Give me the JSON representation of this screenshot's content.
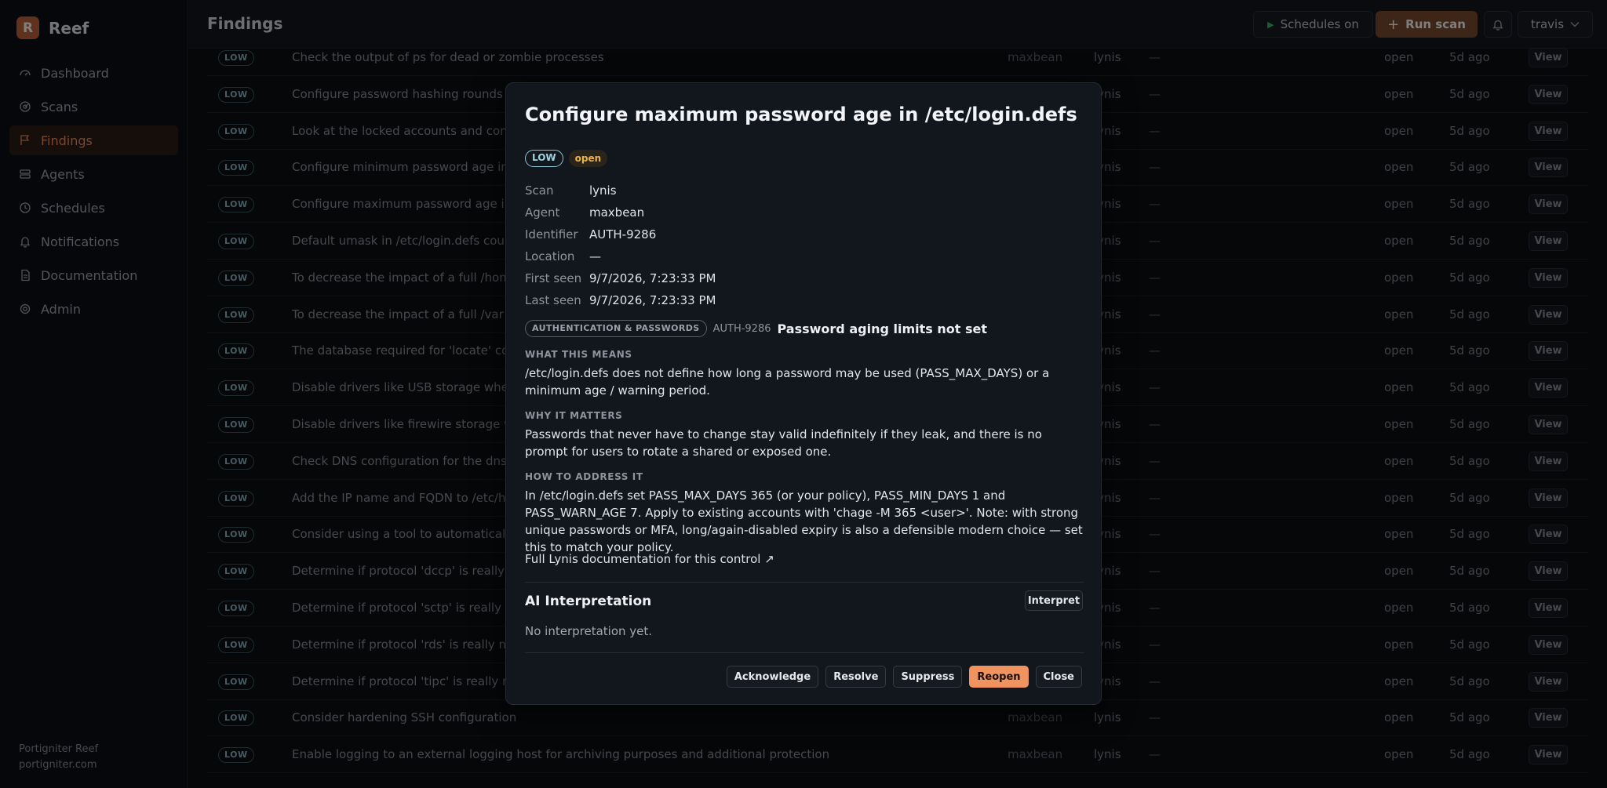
{
  "app": {
    "logo_letter": "R",
    "name": "Reef"
  },
  "sidebar": {
    "items": [
      {
        "label": "Dashboard",
        "icon": "gauge-icon",
        "active": false
      },
      {
        "label": "Scans",
        "icon": "radar-icon",
        "active": false
      },
      {
        "label": "Findings",
        "icon": "flag-icon",
        "active": true
      },
      {
        "label": "Agents",
        "icon": "server-icon",
        "active": false
      },
      {
        "label": "Schedules",
        "icon": "clock-icon",
        "active": false
      },
      {
        "label": "Notifications",
        "icon": "bell-icon",
        "active": false
      },
      {
        "label": "Documentation",
        "icon": "doc-icon",
        "active": false
      },
      {
        "label": "Admin",
        "icon": "gear-icon",
        "active": false
      }
    ],
    "footer": {
      "line1": "Portigniter Reef",
      "line2": "portigniter.com"
    }
  },
  "header": {
    "title": "Findings",
    "schedules_label": "Schedules on",
    "run_scan_label": "Run scan",
    "user": "travis"
  },
  "table": {
    "rows": [
      {
        "severity": "LOW",
        "title": "Check the output of ps for dead or zombie processes",
        "agent": "maxbean",
        "scan": "lynis",
        "location": "—",
        "status": "open",
        "age": "5d ago",
        "view": "View"
      },
      {
        "severity": "LOW",
        "title": "Configure password hashing rounds in",
        "agent": "",
        "scan": "lynis",
        "location": "—",
        "status": "open",
        "age": "5d ago",
        "view": "View"
      },
      {
        "severity": "LOW",
        "title": "Look at the locked accounts and cons",
        "agent": "",
        "scan": "lynis",
        "location": "—",
        "status": "open",
        "age": "5d ago",
        "view": "View"
      },
      {
        "severity": "LOW",
        "title": "Configure minimum password age in",
        "agent": "",
        "scan": "lynis",
        "location": "—",
        "status": "open",
        "age": "5d ago",
        "view": "View"
      },
      {
        "severity": "LOW",
        "title": "Configure maximum password age in",
        "agent": "",
        "scan": "lynis",
        "location": "—",
        "status": "open",
        "age": "5d ago",
        "view": "View"
      },
      {
        "severity": "LOW",
        "title": "Default umask in /etc/login.defs could",
        "agent": "",
        "scan": "lynis",
        "location": "—",
        "status": "open",
        "age": "5d ago",
        "view": "View"
      },
      {
        "severity": "LOW",
        "title": "To decrease the impact of a full /home",
        "agent": "",
        "scan": "lynis",
        "location": "—",
        "status": "open",
        "age": "5d ago",
        "view": "View"
      },
      {
        "severity": "LOW",
        "title": "To decrease the impact of a full /var fi",
        "agent": "",
        "scan": "lynis",
        "location": "—",
        "status": "open",
        "age": "5d ago",
        "view": "View"
      },
      {
        "severity": "LOW",
        "title": "The database required for 'locate' cou",
        "agent": "",
        "scan": "lynis",
        "location": "—",
        "status": "open",
        "age": "5d ago",
        "view": "View"
      },
      {
        "severity": "LOW",
        "title": "Disable drivers like USB storage when n",
        "agent": "",
        "scan": "lynis",
        "location": "—",
        "status": "open",
        "age": "5d ago",
        "view": "View"
      },
      {
        "severity": "LOW",
        "title": "Disable drivers like firewire storage whe",
        "agent": "",
        "scan": "lynis",
        "location": "—",
        "status": "open",
        "age": "5d ago",
        "view": "View"
      },
      {
        "severity": "LOW",
        "title": "Check DNS configuration for the dns do",
        "agent": "",
        "scan": "lynis",
        "location": "—",
        "status": "open",
        "age": "5d ago",
        "view": "View"
      },
      {
        "severity": "LOW",
        "title": "Add the IP name and FQDN to /etc/hos",
        "agent": "",
        "scan": "lynis",
        "location": "—",
        "status": "open",
        "age": "5d ago",
        "view": "View"
      },
      {
        "severity": "LOW",
        "title": "Consider using a tool to automatically",
        "agent": "",
        "scan": "lynis",
        "location": "—",
        "status": "open",
        "age": "5d ago",
        "view": "View"
      },
      {
        "severity": "LOW",
        "title": "Determine if protocol 'dccp' is really ne",
        "agent": "",
        "scan": "lynis",
        "location": "—",
        "status": "open",
        "age": "5d ago",
        "view": "View"
      },
      {
        "severity": "LOW",
        "title": "Determine if protocol 'sctp' is really nee",
        "agent": "",
        "scan": "lynis",
        "location": "—",
        "status": "open",
        "age": "5d ago",
        "view": "View"
      },
      {
        "severity": "LOW",
        "title": "Determine if protocol 'rds' is really need",
        "agent": "",
        "scan": "lynis",
        "location": "—",
        "status": "open",
        "age": "5d ago",
        "view": "View"
      },
      {
        "severity": "LOW",
        "title": "Determine if protocol 'tipc' is really nee",
        "agent": "",
        "scan": "lynis",
        "location": "—",
        "status": "open",
        "age": "5d ago",
        "view": "View"
      },
      {
        "severity": "LOW",
        "title": "Consider hardening SSH configuration",
        "agent": "maxbean",
        "scan": "lynis",
        "location": "—",
        "status": "open",
        "age": "5d ago",
        "view": "View"
      },
      {
        "severity": "LOW",
        "title": "Enable logging to an external logging host for archiving purposes and additional protection",
        "agent": "maxbean",
        "scan": "lynis",
        "location": "—",
        "status": "open",
        "age": "5d ago",
        "view": "View"
      }
    ]
  },
  "modal": {
    "title": "Configure maximum password age in /etc/login.defs",
    "severity": "LOW",
    "status": "open",
    "meta": [
      {
        "key": "Scan",
        "value": "lynis"
      },
      {
        "key": "Agent",
        "value": "maxbean"
      },
      {
        "key": "Identifier",
        "value": "AUTH-9286"
      },
      {
        "key": "Location",
        "value": "—"
      },
      {
        "key": "First seen",
        "value": "9/7/2026, 7:23:33 PM"
      },
      {
        "key": "Last seen",
        "value": "9/7/2026, 7:23:33 PM"
      }
    ],
    "category": "AUTHENTICATION & PASSWORDS",
    "control_id": "AUTH-9286",
    "control_name": "Password aging limits not set",
    "what_heading": "WHAT THIS MEANS",
    "what_text": "/etc/login.defs does not define how long a password may be used (PASS_MAX_DAYS) or a minimum age / warning period.",
    "why_heading": "WHY IT MATTERS",
    "why_text": "Passwords that never have to change stay valid indefinitely if they leak, and there is no prompt for users to rotate a shared or exposed one.",
    "how_heading": "HOW TO ADDRESS IT",
    "how_text": "In /etc/login.defs set PASS_MAX_DAYS 365 (or your policy), PASS_MIN_DAYS 1 and PASS_WARN_AGE 7. Apply to existing accounts with 'chage -M 365 <user>'. Note: with strong unique passwords or MFA, long/again-disabled expiry is also a defensible modern choice — set this to match your policy.",
    "doc_link": "Full Lynis documentation for this control ↗",
    "ai_title": "AI Interpretation",
    "interpret_label": "Interpret",
    "ai_empty": "No interpretation yet.",
    "actions": [
      "Acknowledge",
      "Resolve",
      "Suppress",
      "Reopen",
      "Close"
    ]
  },
  "colors": {
    "accent": "#f0935e",
    "low_badge": "#8cc6d6",
    "open_badge": "#e9b44c"
  }
}
